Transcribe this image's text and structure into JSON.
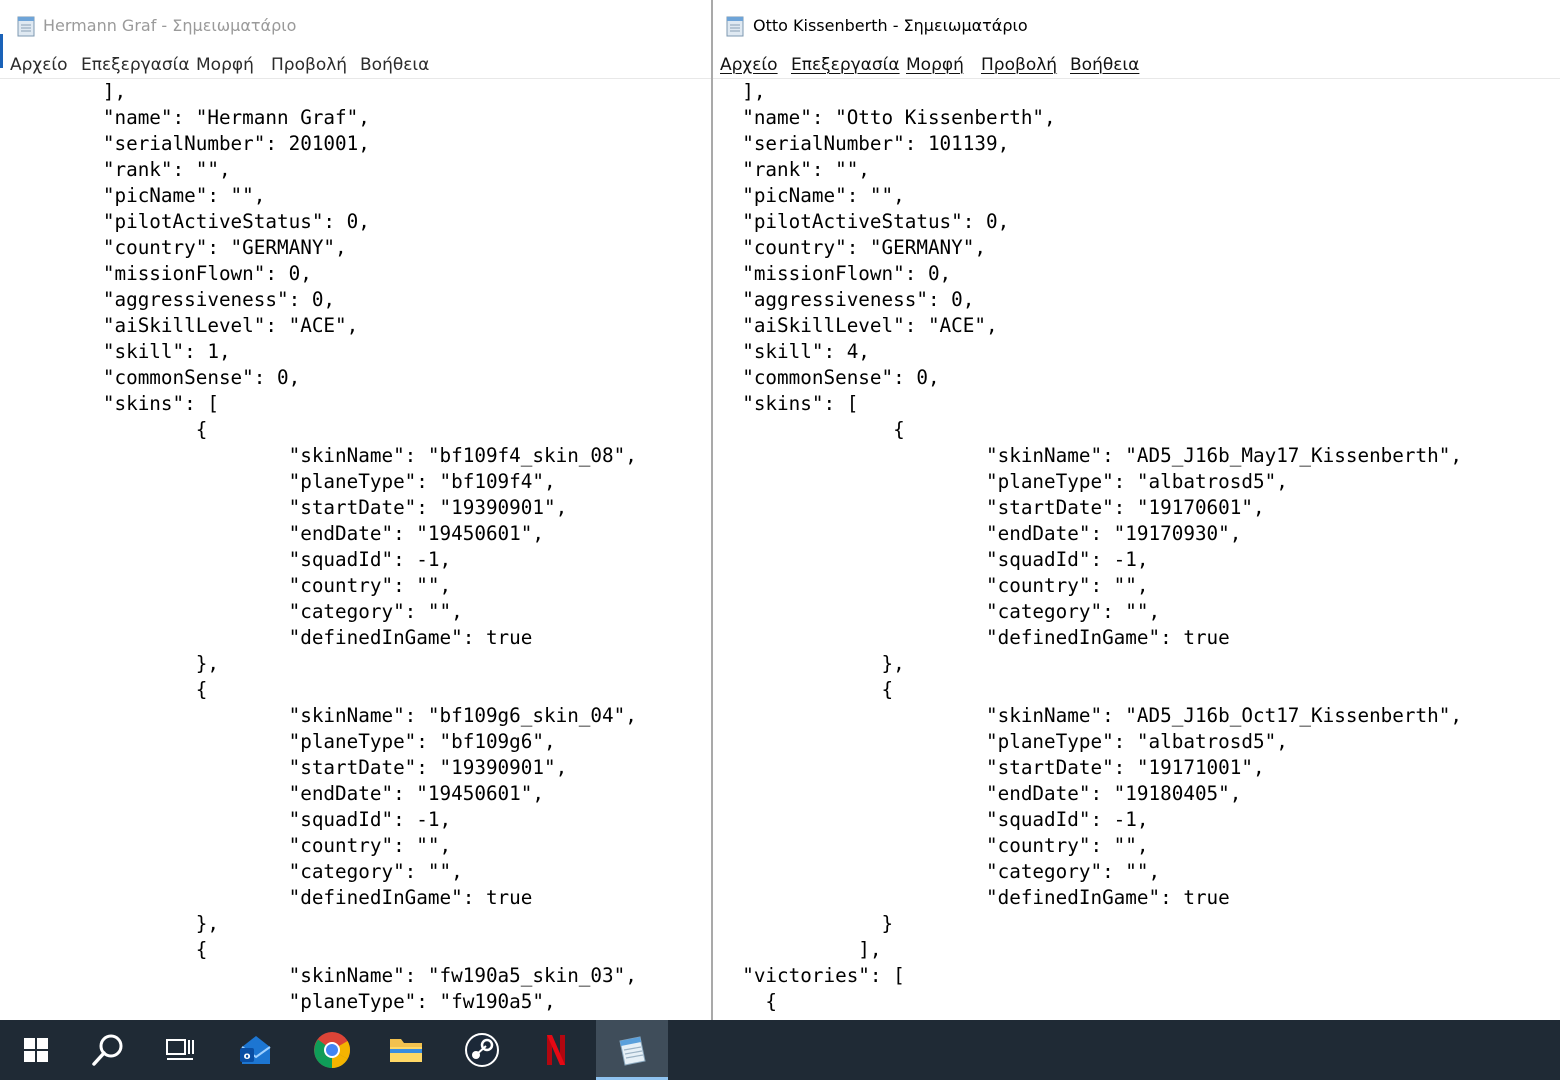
{
  "left_window": {
    "title": "Hermann Graf - Σημειωματάριο",
    "menu": [
      "Αρχείο",
      "Επεξεργασία",
      "Μορφή",
      "Προβολή",
      "Βοήθεια"
    ],
    "content": "        ],\n        \"name\": \"Hermann Graf\",\n        \"serialNumber\": 201001,\n        \"rank\": \"\",\n        \"picName\": \"\",\n        \"pilotActiveStatus\": 0,\n        \"country\": \"GERMANY\",\n        \"missionFlown\": 0,\n        \"aggressiveness\": 0,\n        \"aiSkillLevel\": \"ACE\",\n        \"skill\": 1,\n        \"commonSense\": 0,\n        \"skins\": [\n                {\n                        \"skinName\": \"bf109f4_skin_08\",\n                        \"planeType\": \"bf109f4\",\n                        \"startDate\": \"19390901\",\n                        \"endDate\": \"19450601\",\n                        \"squadId\": -1,\n                        \"country\": \"\",\n                        \"category\": \"\",\n                        \"definedInGame\": true\n                },\n                {\n                        \"skinName\": \"bf109g6_skin_04\",\n                        \"planeType\": \"bf109g6\",\n                        \"startDate\": \"19390901\",\n                        \"endDate\": \"19450601\",\n                        \"squadId\": -1,\n                        \"country\": \"\",\n                        \"category\": \"\",\n                        \"definedInGame\": true\n                },\n                {\n                        \"skinName\": \"fw190a5_skin_03\",\n                        \"planeType\": \"fw190a5\","
  },
  "right_window": {
    "title": "Otto Kissenberth - Σημειωματάριο",
    "menu": [
      "Αρχείο",
      "Επεξεργασία",
      "Μορφή",
      "Προβολή",
      "Βοήθεια"
    ],
    "content": "  ],\n  \"name\": \"Otto Kissenberth\",\n  \"serialNumber\": 101139,\n  \"rank\": \"\",\n  \"picName\": \"\",\n  \"pilotActiveStatus\": 0,\n  \"country\": \"GERMANY\",\n  \"missionFlown\": 0,\n  \"aggressiveness\": 0,\n  \"aiSkillLevel\": \"ACE\",\n  \"skill\": 4,\n  \"commonSense\": 0,\n  \"skins\": [\n               {\n                       \"skinName\": \"AD5_J16b_May17_Kissenberth\",\n                       \"planeType\": \"albatrosd5\",\n                       \"startDate\": \"19170601\",\n                       \"endDate\": \"19170930\",\n                       \"squadId\": -1,\n                       \"country\": \"\",\n                       \"category\": \"\",\n                       \"definedInGame\": true\n              },\n              {\n                       \"skinName\": \"AD5_J16b_Oct17_Kissenberth\",\n                       \"planeType\": \"albatrosd5\",\n                       \"startDate\": \"19171001\",\n                       \"endDate\": \"19180405\",\n                       \"squadId\": -1,\n                       \"country\": \"\",\n                       \"category\": \"\",\n                       \"definedInGame\": true\n              }\n            ],\n  \"victories\": [\n    {"
  },
  "taskbar": {
    "icons": [
      "windows-start-icon",
      "search-icon",
      "task-view-icon",
      "mail-app-icon",
      "chrome-icon",
      "file-explorer-icon",
      "steam-icon",
      "netflix-icon",
      "notepad-icon"
    ],
    "active": "notepad-icon",
    "colors": {
      "background": "#1f2a35",
      "active": "#3f4d5a"
    }
  }
}
